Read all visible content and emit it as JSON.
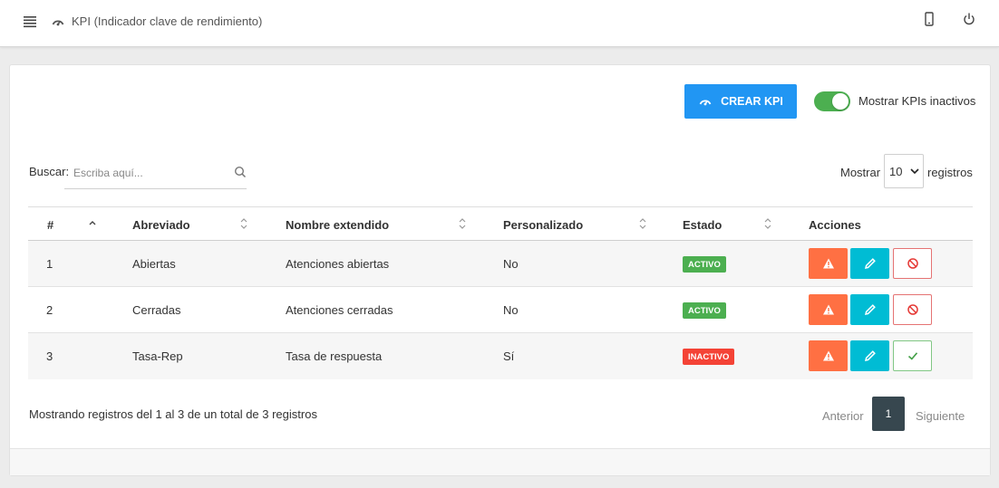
{
  "header": {
    "title": "KPI (Indicador clave de rendimiento)",
    "icons": [
      "menu-icon",
      "gauge-icon",
      "mobile-icon",
      "power-icon"
    ]
  },
  "toolbar": {
    "create_label": "CREAR KPI",
    "toggle_label": "Mostrar KPIs inactivos",
    "toggle_on": true
  },
  "search": {
    "label": "Buscar:",
    "placeholder": "Escriba aquí..."
  },
  "length": {
    "prefix": "Mostrar",
    "value": "10",
    "suffix": "registros"
  },
  "table": {
    "columns": [
      "#",
      "Abreviado",
      "Nombre extendido",
      "Personalizado",
      "Estado",
      "Acciones"
    ],
    "rows": [
      {
        "num": "1",
        "abbr": "Abiertas",
        "name": "Atenciones abiertas",
        "custom": "No",
        "status": "ACTIVO"
      },
      {
        "num": "2",
        "abbr": "Cerradas",
        "name": "Atenciones cerradas",
        "custom": "No",
        "status": "ACTIVO"
      },
      {
        "num": "3",
        "abbr": "Tasa-Rep",
        "name": "Tasa de respuesta",
        "custom": "Sí",
        "status": "INACTIVO"
      }
    ]
  },
  "footer": {
    "summary": "Mostrando registros del 1 al 3 de un total de 3 registros",
    "prev": "Anterior",
    "page": "1",
    "next": "Siguiente"
  },
  "colors": {
    "primary": "#2196f3",
    "success": "#4caf50",
    "danger": "#f44336",
    "warning": "#ff7043",
    "info": "#00bcd4",
    "page_active": "#37474f"
  }
}
